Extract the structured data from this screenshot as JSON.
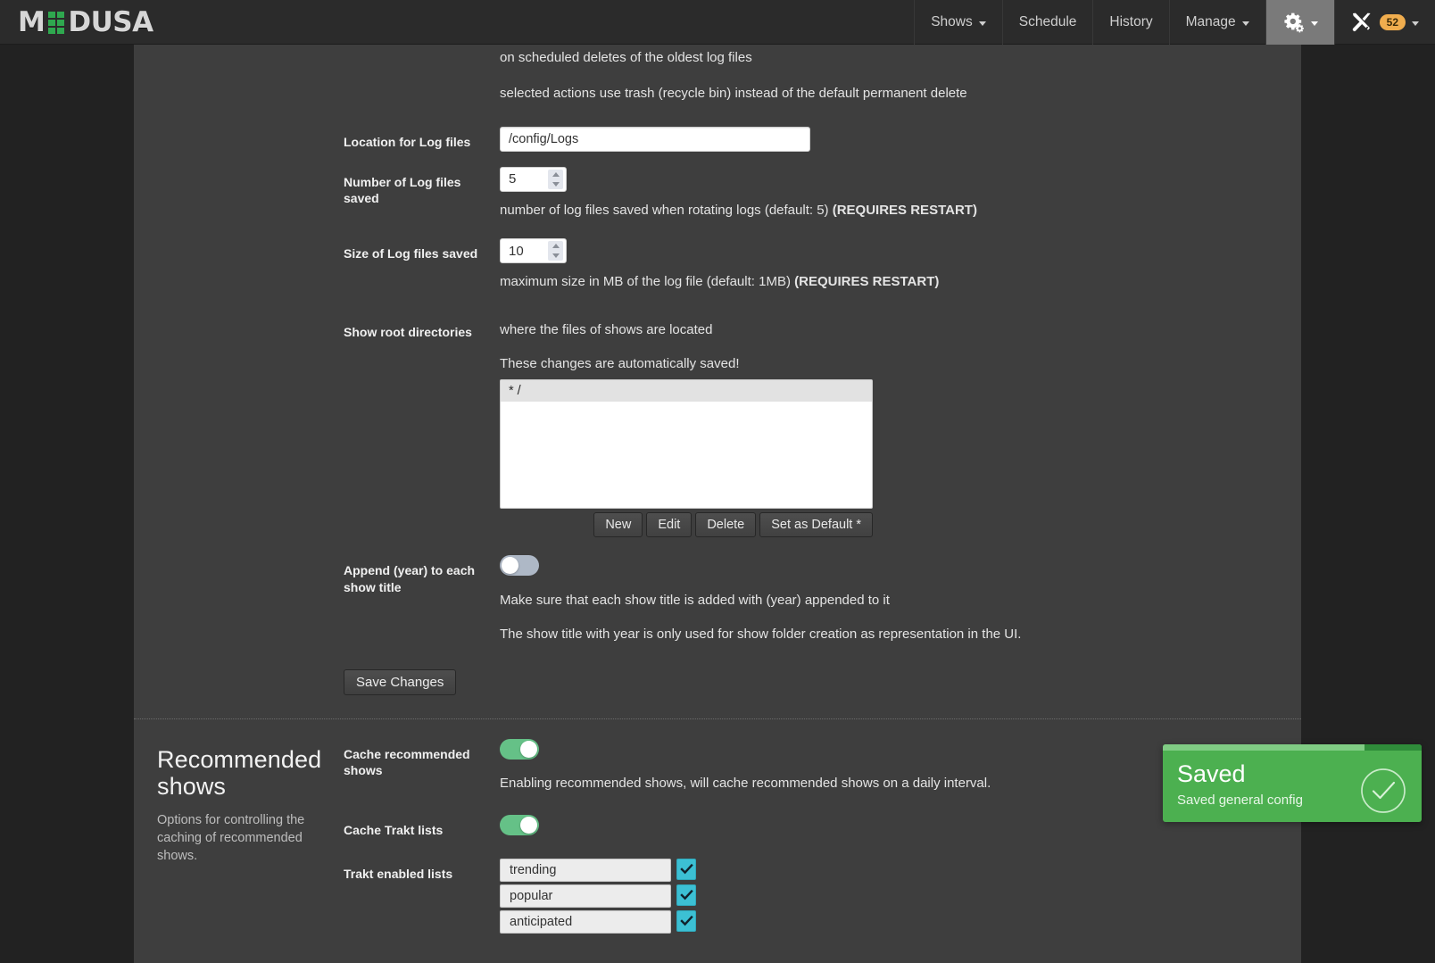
{
  "header": {
    "logo_text_1": "M",
    "logo_icon": "green-dot-grid",
    "logo_text_2": "DUSA",
    "nav": [
      {
        "label": "Shows",
        "caret": true,
        "active": false,
        "icon": null
      },
      {
        "label": "Schedule",
        "caret": false,
        "active": false,
        "icon": null
      },
      {
        "label": "History",
        "caret": false,
        "active": false,
        "icon": null
      },
      {
        "label": "Manage",
        "caret": true,
        "active": false,
        "icon": null
      },
      {
        "label": "",
        "caret": true,
        "active": true,
        "icon": "gears-icon"
      },
      {
        "label": "",
        "caret": true,
        "active": false,
        "icon": "tools-icon",
        "badge": "52"
      }
    ]
  },
  "general": {
    "help_line_1": "on scheduled deletes of the oldest log files",
    "help_line_2": "selected actions use trash (recycle bin) instead of the default permanent delete",
    "log_location": {
      "label": "Location for Log files",
      "value": "/config/Logs",
      "placeholder": ""
    },
    "log_count": {
      "label": "Number of Log files saved",
      "value": "5",
      "help_plain": "number of log files saved when rotating logs (default: 5) ",
      "help_bold": "(REQUIRES RESTART)"
    },
    "log_size": {
      "label": "Size of Log files saved",
      "value": "10",
      "help_plain": "maximum size in MB of the log file (default: 1MB) ",
      "help_bold": "(REQUIRES RESTART)"
    },
    "root_dirs": {
      "label": "Show root directories",
      "help_1": "where the files of shows are located",
      "help_2": "These changes are automatically saved!",
      "options": [
        "* /"
      ],
      "buttons": [
        "New",
        "Edit",
        "Delete",
        "Set as Default *"
      ]
    },
    "append_year": {
      "label": "Append (year) to each show title",
      "state": "off",
      "help_1": "Make sure that each show title is added with (year) appended to it",
      "help_2": "The show title with year is only used for show folder creation as representation in the UI."
    },
    "save_label": "Save Changes"
  },
  "recommended": {
    "title": "Recommended shows",
    "description": "Options for controlling the caching of recommended shows.",
    "cache_recommended": {
      "label": "Cache recommended shows",
      "state": "on",
      "help": "Enabling recommended shows, will cache recommended shows on a daily interval."
    },
    "cache_trakt": {
      "label": "Cache Trakt lists",
      "state": "on"
    },
    "trakt_lists": {
      "label": "Trakt enabled lists",
      "items": [
        {
          "name": "trending",
          "checked": true
        },
        {
          "name": "popular",
          "checked": true
        },
        {
          "name": "anticipated",
          "checked": true
        }
      ]
    }
  },
  "toast": {
    "title": "Saved",
    "message": "Saved general config",
    "icon": "check-circle-icon",
    "progress_percent": 78,
    "color": "#4cb050"
  }
}
